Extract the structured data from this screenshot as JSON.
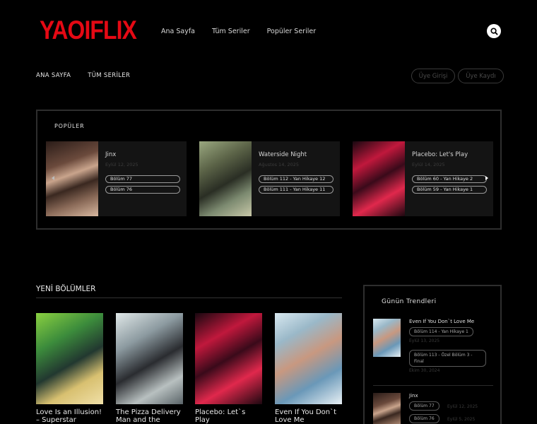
{
  "site": {
    "logo": "YAOIFLIX"
  },
  "topnav": [
    "Ana Sayfa",
    "Tüm Seriler",
    "Popüler Seriler"
  ],
  "subnav": [
    "ANA SAYFA",
    "TÜM SERİLER"
  ],
  "auth": {
    "login": "Üye Girişi",
    "register": "Üye Kaydı"
  },
  "popular": {
    "title": "POPÜLER",
    "cards": [
      {
        "title": "Jinx",
        "date": "Eylül 12, 2025",
        "chips": [
          "Bölüm 77",
          "Bölüm 76"
        ]
      },
      {
        "title": "Waterside Night",
        "date": "Ağustos 14, 2025",
        "chips": [
          "Bölüm 112 - Yan Hikaye 12",
          "Bölüm 111 - Yan Hikaye 11"
        ]
      },
      {
        "title": "Placebo: Let's Play",
        "date": "Eylül 14, 2025",
        "chips": [
          "Bölüm 60 - Yan Hikaye 2",
          "Bölüm 59 - Yan Hikaye 1"
        ]
      }
    ]
  },
  "new_chapters": {
    "title": "YENİ BÖLÜMLER",
    "items": [
      {
        "title": "Love Is an Illusion! – Superstar"
      },
      {
        "title": "The Pizza Delivery Man and the Gold..."
      },
      {
        "title": "Placebo: Let`s Play"
      },
      {
        "title": "Even If You Don`t Love Me"
      }
    ]
  },
  "trending": {
    "title": "Günün Trendleri",
    "items": [
      {
        "title": "Even If You Don`t Love Me",
        "chip1": "Bölüm 114 - Yan Hikaye 1",
        "date1": "Eylül 13, 2025",
        "chip2": "Bölüm 113 - Özel Bölüm 3 - Final",
        "date2": "Ekim 30, 2024"
      },
      {
        "title": "Jinx",
        "chip1": "Bölüm 77",
        "date1": "Eylül 12, 2025",
        "chip2": "Bölüm 76",
        "date2": "Eylül 5, 2025"
      }
    ]
  },
  "colors": {
    "brand": "#e50914",
    "background": "#000000"
  }
}
